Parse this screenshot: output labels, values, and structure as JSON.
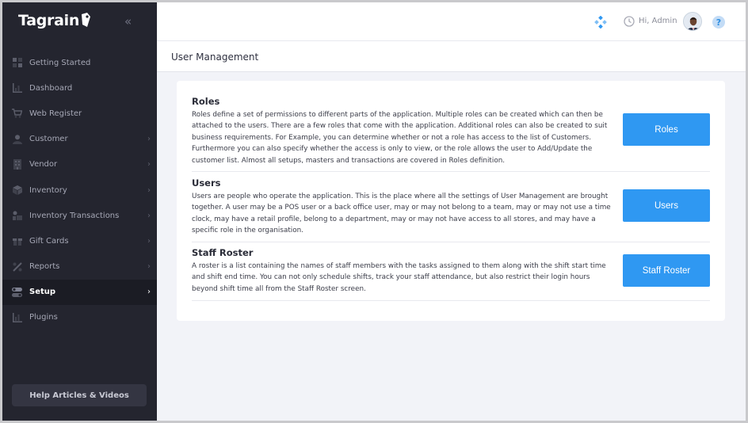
{
  "app": {
    "brand": "Tagrain"
  },
  "sidebar": {
    "items": [
      {
        "label": "Getting Started",
        "icon": "grid-icon",
        "chevron": ""
      },
      {
        "label": "Dashboard",
        "icon": "bar-chart-icon",
        "chevron": ""
      },
      {
        "label": "Web Register",
        "icon": "cart-icon",
        "chevron": ""
      },
      {
        "label": "Customer",
        "icon": "person-icon",
        "chevron": "›"
      },
      {
        "label": "Vendor",
        "icon": "building-icon",
        "chevron": "›"
      },
      {
        "label": "Inventory",
        "icon": "box-icon",
        "chevron": "›"
      },
      {
        "label": "Inventory Transactions",
        "icon": "transactions-icon",
        "chevron": "›"
      },
      {
        "label": "Gift Cards",
        "icon": "gift-icon",
        "chevron": "›"
      },
      {
        "label": "Reports",
        "icon": "reports-icon",
        "chevron": "›"
      },
      {
        "label": "Setup",
        "icon": "toggle-icon",
        "chevron": "›",
        "active": true
      },
      {
        "label": "Plugins",
        "icon": "plugins-icon",
        "chevron": ""
      }
    ],
    "help_label": "Help Articles & Videos",
    "collapse_glyph": "«"
  },
  "header": {
    "greeting": "Hi, Admin",
    "help_glyph": "?"
  },
  "page": {
    "title": "User Management"
  },
  "sections": [
    {
      "title": "Roles",
      "description": "Roles define a set of permissions to different parts of the application. Multiple roles can be created which can then be attached to the users. There are a few roles that come with the application. Additional roles can also be created to suit business requirements. For Example, you can determine whether or not a role has access to the list of Customers. Furthermore you can also specify whether the access is only to view, or the role allows the user to Add/Update the customer list. Almost all setups, masters and transactions are covered in Roles definition.",
      "button": "Roles"
    },
    {
      "title": "Users",
      "description": "Users are people who operate the application. This is the place where all the settings of User Management are brought together. A user may be a POS user or a back office user, may or may not belong to a team, may or may not use a time clock, may have a retail profile, belong to a department, may or may not have access to all stores, and may have a specific role in the organisation.",
      "button": "Users"
    },
    {
      "title": "Staff Roster",
      "description": "A roster is a list containing the names of staff members with the tasks assigned to them along with the shift start time and shift end time. You can not only schedule shifts, track your staff attendance, but also restrict their login hours beyond shift time all from the Staff Roster screen.",
      "button": "Staff Roster"
    }
  ],
  "colors": {
    "sidebar_bg": "#24252f",
    "accent_blue": "#2f98f2",
    "page_bg": "#f2f3f8"
  }
}
